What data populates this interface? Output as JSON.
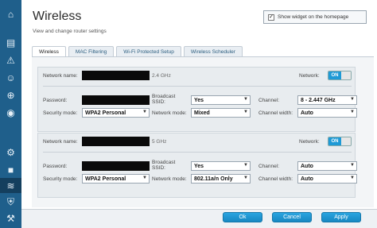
{
  "sidebar": {
    "icons": [
      "home-icon",
      "router-icon",
      "alert-icon",
      "parental-icon",
      "network-map-icon",
      "speed-test-icon",
      "settings-icon",
      "camera-icon",
      "wifi-icon",
      "security-icon",
      "tools-icon"
    ]
  },
  "header": {
    "title": "Wireless",
    "subtitle": "View and change router settings",
    "widget_checkbox_label": "Show widget on the homepage",
    "widget_checked": true
  },
  "tabs": [
    {
      "label": "Wireless",
      "active": true
    },
    {
      "label": "MAC Filtering",
      "active": false
    },
    {
      "label": "Wi-Fi Protected Setup",
      "active": false
    },
    {
      "label": "Wireless Scheduler",
      "active": false
    }
  ],
  "bands": [
    {
      "band_label": "2.4 GHz",
      "network_name_label": "Network name:",
      "network_label": "Network:",
      "network_toggle": "ON",
      "password_label": "Password:",
      "broadcast_ssid_label": "Broadcast SSID:",
      "broadcast_ssid_value": "Yes",
      "channel_label": "Channel:",
      "channel_value": "8 - 2.447 GHz",
      "security_mode_label": "Security mode:",
      "security_mode_value": "WPA2 Personal",
      "network_mode_label": "Network mode:",
      "network_mode_value": "Mixed",
      "channel_width_label": "Channel width:",
      "channel_width_value": "Auto"
    },
    {
      "band_label": "5 GHz",
      "network_name_label": "Network name:",
      "network_label": "Network:",
      "network_toggle": "ON",
      "password_label": "Password:",
      "broadcast_ssid_label": "Broadcast SSID:",
      "broadcast_ssid_value": "Yes",
      "channel_label": "Channel:",
      "channel_value": "Auto",
      "security_mode_label": "Security mode:",
      "security_mode_value": "WPA2 Personal",
      "network_mode_label": "Network mode:",
      "network_mode_value": "802.11a/n Only",
      "channel_width_label": "Channel width:",
      "channel_width_value": "Auto"
    }
  ],
  "footer": {
    "ok_label": "Ok",
    "cancel_label": "Cancel",
    "apply_label": "Apply"
  },
  "colors": {
    "sidebar": "#1f5f8b",
    "accent": "#1e9ad6",
    "redaction": "#0a0a0a"
  }
}
